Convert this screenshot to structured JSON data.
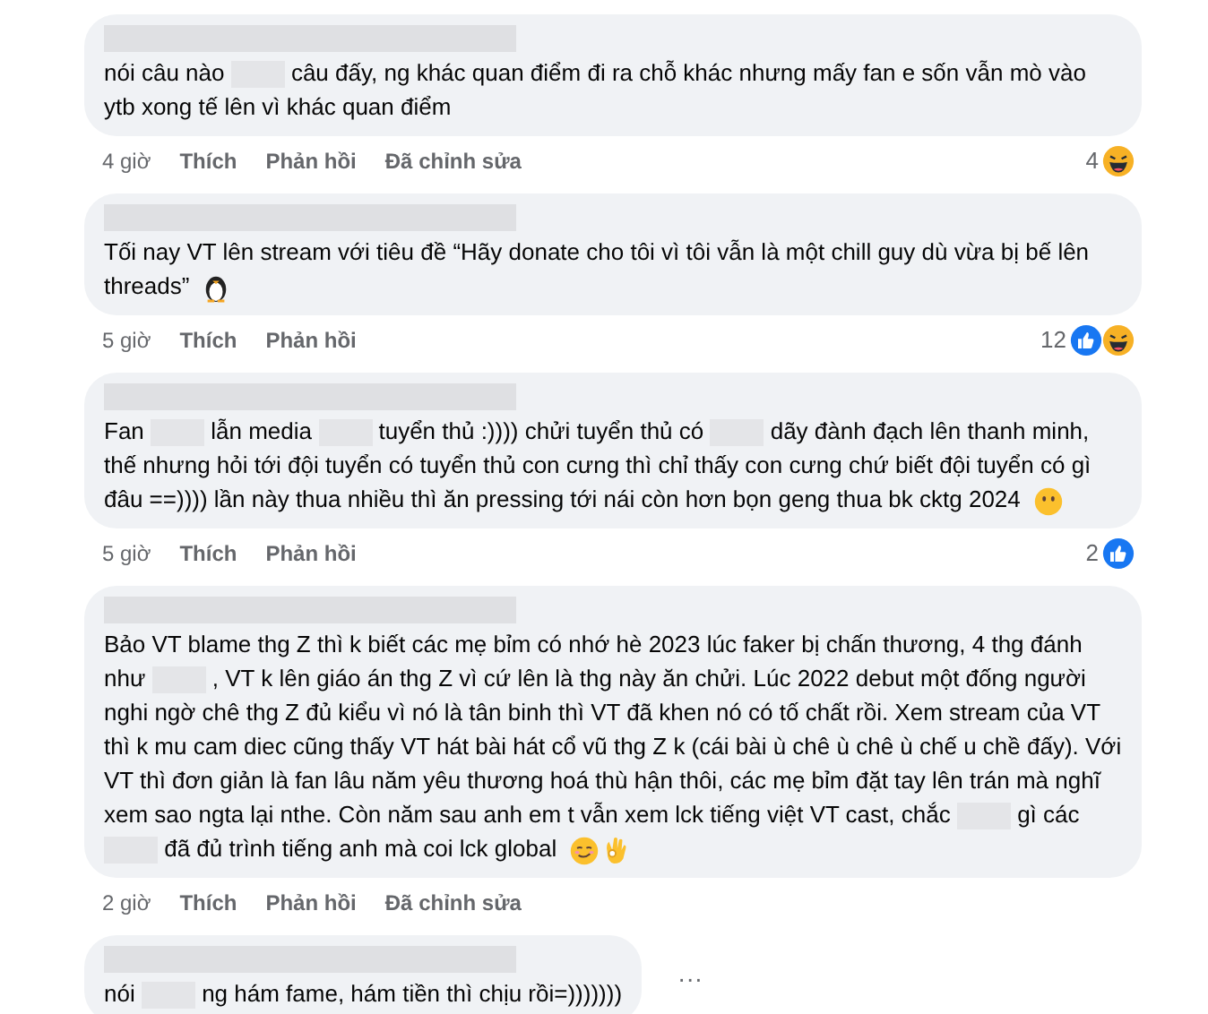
{
  "comments": [
    {
      "body": [
        {
          "kind": "text",
          "text": "nói câu nào"
        },
        {
          "kind": "blur"
        },
        {
          "kind": "text",
          "text": "câu đấy, ng khác quan điểm đi ra chỗ khác nhưng mấy fan e sốn vẫn mò vào ytb xong tế lên vì khác quan điểm"
        }
      ],
      "time": "4 giờ",
      "like": "Thích",
      "reply": "Phản hồi",
      "edited": "Đã chỉnh sửa",
      "reaction_count": "4",
      "reactions": [
        {
          "kind": "haha"
        }
      ]
    },
    {
      "body": [
        {
          "kind": "text",
          "text": "Tối nay VT lên stream với tiêu đề “Hãy donate cho tôi vì tôi vẫn là một chill guy dù vừa bị bế lên threads”"
        },
        {
          "kind": "penguin"
        }
      ],
      "time": "5 giờ",
      "like": "Thích",
      "reply": "Phản hồi",
      "reaction_count": "12",
      "reactions": [
        {
          "kind": "like"
        },
        {
          "kind": "haha"
        }
      ]
    },
    {
      "body": [
        {
          "kind": "text",
          "text": "Fan"
        },
        {
          "kind": "blur"
        },
        {
          "kind": "text",
          "text": "lẫn media"
        },
        {
          "kind": "blur"
        },
        {
          "kind": "text",
          "text": "tuyển thủ :)))) chửi tuyển thủ có"
        },
        {
          "kind": "blur"
        },
        {
          "kind": "text",
          "text": "dãy đành đạch lên thanh minh, thế nhưng hỏi tới đội tuyển có tuyển thủ con cưng thì chỉ thấy con cưng chứ biết đội tuyển có gì đâu ==)))) lần này thua nhiều thì ăn pressing tới nái còn hơn bọn geng thua bk cktg 2024"
        },
        {
          "kind": "hush"
        }
      ],
      "time": "5 giờ",
      "like": "Thích",
      "reply": "Phản hồi",
      "reaction_count": "2",
      "reactions": [
        {
          "kind": "like"
        }
      ]
    },
    {
      "body": [
        {
          "kind": "text",
          "text": "Bảo VT blame thg Z thì k biết các mẹ bỉm có nhớ hè 2023 lúc faker bị chấn thương, 4 thg đánh như"
        },
        {
          "kind": "blur"
        },
        {
          "kind": "text",
          "text": ", VT k lên giáo án thg Z vì cứ lên là thg này ăn chửi. Lúc 2022 debut một đống người nghi ngờ chê thg Z đủ kiểu vì nó là tân binh thì VT đã khen nó có tố chất rồi. Xem stream của VT thì k mu cam diec cũng thấy VT hát bài hát cổ vũ thg Z k (cái bài ù chê ù chê ù chế u chề đấy). Với VT thì đơn giản là fan lâu năm yêu thương hoá thù hận thôi, các mẹ bỉm đặt tay lên trán mà nghĩ xem sao ngta lại nthe. Còn năm sau anh em t vẫn xem lck tiếng việt VT cast, chắc"
        },
        {
          "kind": "blur"
        },
        {
          "kind": "text",
          "text": "gì các"
        },
        {
          "kind": "blur"
        },
        {
          "kind": "text",
          "text": "đã đủ trình tiếng anh mà coi lck global"
        },
        {
          "kind": "smirk"
        },
        {
          "kind": "ok"
        }
      ],
      "time": "2 giờ",
      "like": "Thích",
      "reply": "Phản hồi",
      "edited": "Đã chỉnh sửa"
    },
    {
      "body": [
        {
          "kind": "text",
          "text": "nói"
        },
        {
          "kind": "blur"
        },
        {
          "kind": "text",
          "text": "ng hám fame, hám tiền thì chịu rồi=)))))))"
        }
      ],
      "more_label": "···"
    }
  ]
}
